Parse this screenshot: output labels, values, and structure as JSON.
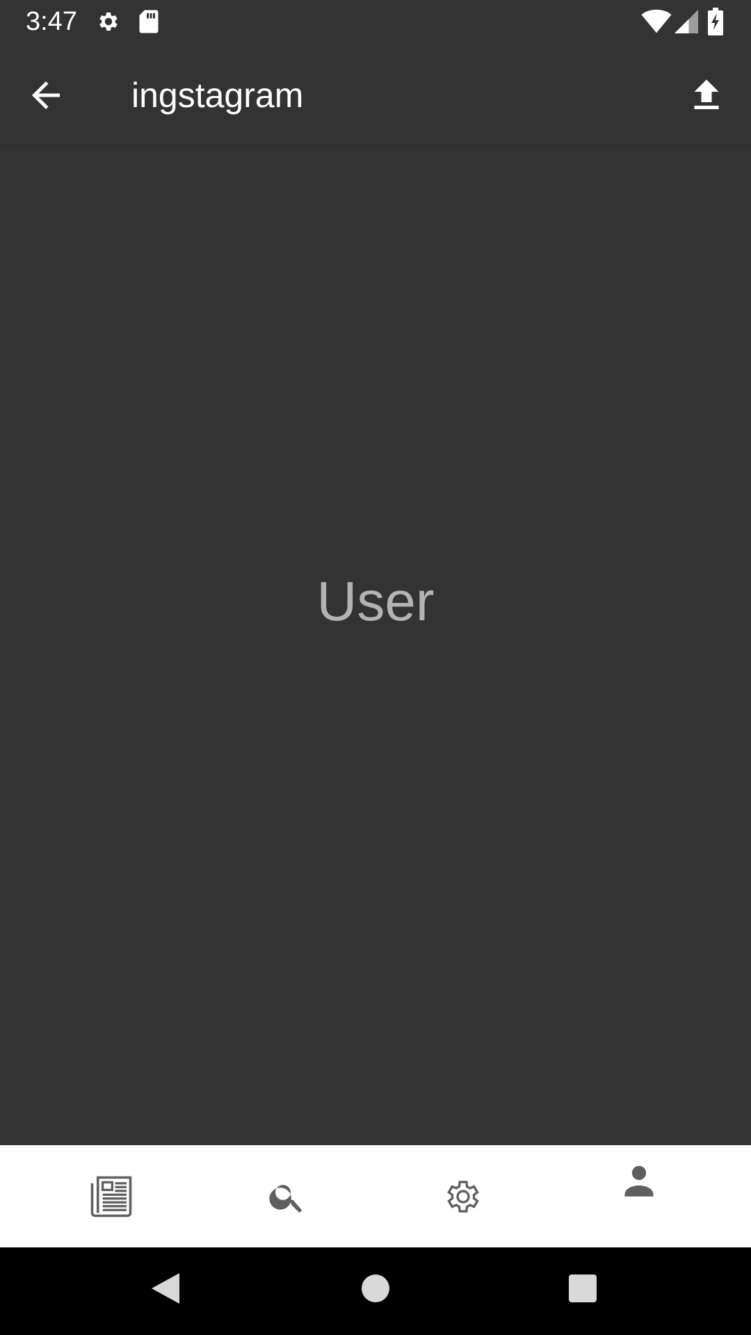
{
  "status_bar": {
    "time": "3:47",
    "icons": [
      "settings-icon",
      "sd-card-icon",
      "wifi-icon",
      "cell-signal-icon",
      "battery-charging-icon"
    ]
  },
  "app_bar": {
    "title": "ingstagram",
    "back_icon": "arrow-back-icon",
    "upload_icon": "upload-icon"
  },
  "main": {
    "label": "User"
  },
  "bottom_nav": {
    "items": [
      {
        "icon": "newspaper-icon",
        "active": false
      },
      {
        "icon": "search-icon",
        "active": false
      },
      {
        "icon": "gear-icon",
        "active": false
      },
      {
        "icon": "person-icon",
        "active": true
      }
    ]
  },
  "system_nav": {
    "buttons": [
      "back-triangle-icon",
      "home-circle-icon",
      "recents-square-icon"
    ]
  },
  "colors": {
    "background": "#333333",
    "bottom_nav_bg": "#ffffff",
    "icon_gray": "#5f5f5f",
    "label_gray": "#b3b3b3"
  }
}
